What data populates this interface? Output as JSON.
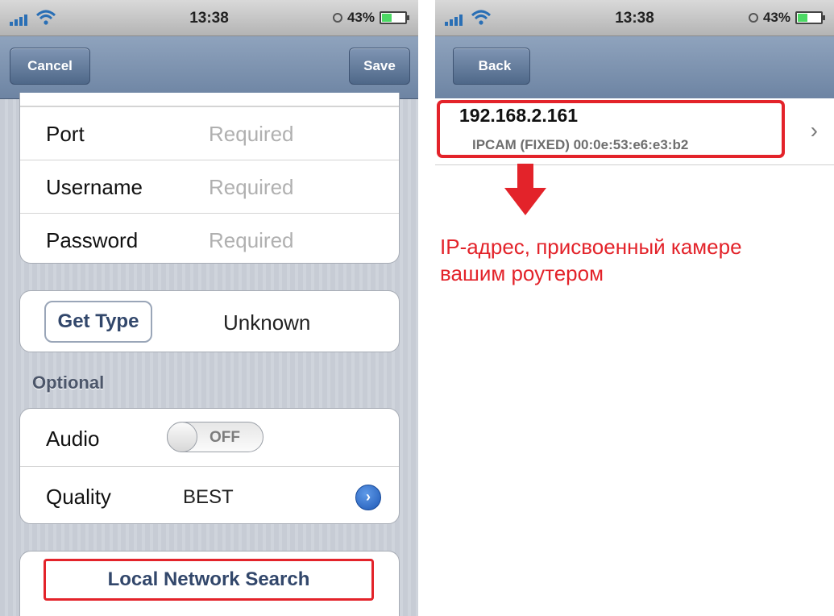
{
  "left_screen": {
    "status": {
      "time": "13:38",
      "battery_percent": "43%",
      "battery_level": 0.43
    },
    "nav": {
      "cancel_label": "Cancel",
      "save_label": "Save"
    },
    "fields": [
      {
        "label": "Port",
        "placeholder": "Required"
      },
      {
        "label": "Username",
        "placeholder": "Required"
      },
      {
        "label": "Password",
        "placeholder": "Required"
      }
    ],
    "type": {
      "button_label": "Get Type",
      "value": "Unknown"
    },
    "optional_header": "Optional",
    "audio": {
      "label": "Audio",
      "state": "OFF"
    },
    "quality": {
      "label": "Quality",
      "value": "BEST"
    },
    "search_label": "Local Network Search",
    "colors": {
      "highlight": "#e3232a",
      "button_text": "#32476b",
      "nav": "#6d84a3"
    }
  },
  "right_screen": {
    "status": {
      "time": "13:38",
      "battery_percent": "43%",
      "battery_level": 0.43
    },
    "nav": {
      "back_label": "Back"
    },
    "device": {
      "ip": "192.168.2.161",
      "info": "IPCAM (FIXED)  00:0e:53:e6:e3:b2"
    },
    "annotation_lines": [
      "IP-адрес, присвоенный камере",
      "вашим роутером"
    ]
  }
}
